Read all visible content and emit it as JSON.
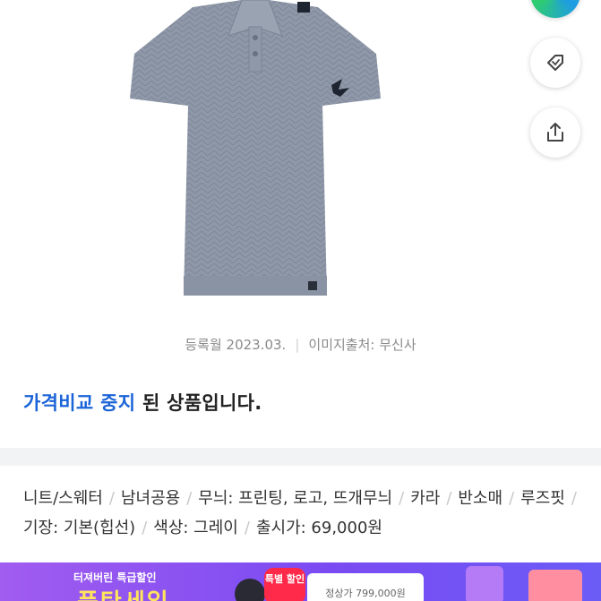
{
  "product": {
    "image_alt": "grey knit polo shirt",
    "colors": {
      "knit": "#8f98a8",
      "knit_dark": "#7a8394",
      "background": "#ffffff"
    }
  },
  "actions": {
    "like_icon": "heart-tag-icon",
    "share_icon": "share-icon"
  },
  "meta": {
    "registered": "등록월 2023.03.",
    "image_source": "이미지출처: 무신사"
  },
  "status": {
    "accent_text": "가격비교 중지",
    "rest_text": " 된 상품입니다.",
    "accent_color": "#1b64d8"
  },
  "specs": {
    "items": [
      "니트/스웨터",
      "남녀공용",
      "무늬: 프린팅, 로고, 뜨개무늬",
      "카라",
      "반소매",
      "루즈핏",
      "기장: 기본(힙선)",
      "색상: 그레이",
      "출시가: 69,000원"
    ]
  },
  "banner": {
    "subtitle": "터져버린 특급할인",
    "title": "풍탄세일",
    "badge": "특별 할인",
    "price": "정상가 799,000원"
  }
}
